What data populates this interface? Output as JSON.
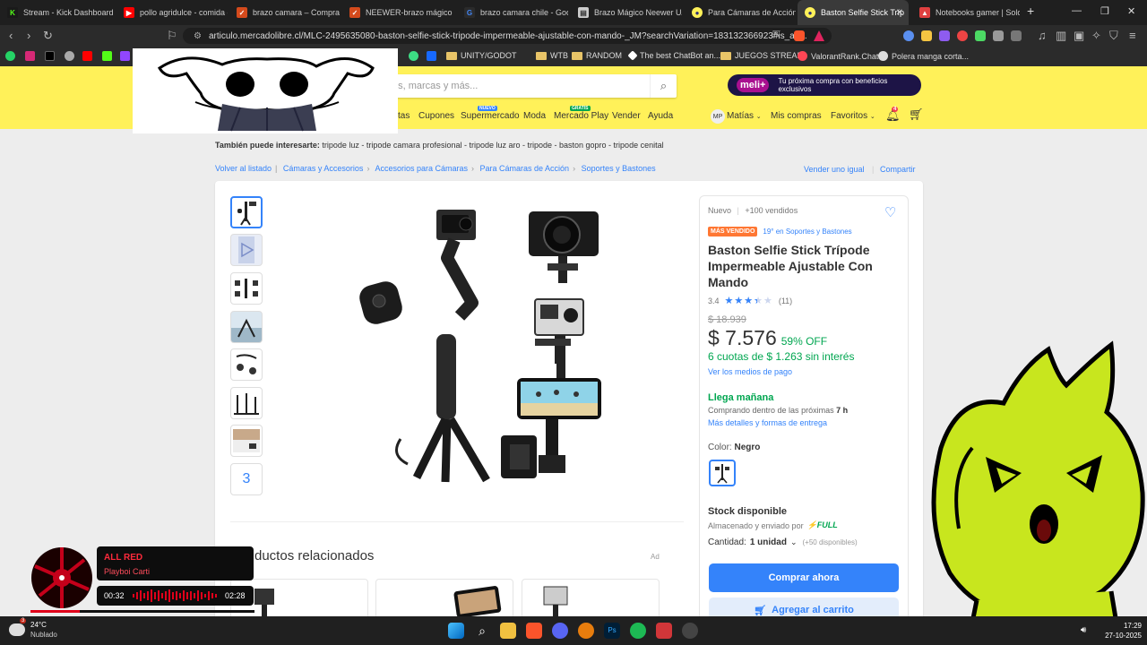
{
  "browser": {
    "tabs": [
      {
        "title": "Stream - Kick Dashboard",
        "icon": "kick-icon",
        "color": "#53fc18"
      },
      {
        "title": "pollo agridulce - comida c",
        "icon": "youtube-icon",
        "color": "#ff0000"
      },
      {
        "title": "brazo camara – Compra b",
        "icon": "mercadolibre-icon",
        "color": "#d44a1c"
      },
      {
        "title": "NEEWER-brazo mágico de",
        "icon": "aliexpress-icon",
        "color": "#d44a1c"
      },
      {
        "title": "brazo camara chile - Goog",
        "icon": "google-icon",
        "color": "#4285f4"
      },
      {
        "title": "Brazo Mágico Neewer UA",
        "icon": "page-icon",
        "color": "#cccccc"
      },
      {
        "title": "Para Cámaras de Acción S",
        "icon": "mercadolibre-icon",
        "color": "#fff159"
      },
      {
        "title": "Baston Selfie Stick Tríp",
        "icon": "mercadolibre-icon",
        "color": "#fff159",
        "active": true
      },
      {
        "title": "Notebooks gamer | SoloTo",
        "icon": "solotodo-icon",
        "color": "#e04040"
      }
    ],
    "new_tab": "+",
    "url": "articulo.mercadolibre.cl/MLC-2495635080-baston-selfie-stick-tripode-impermeable-ajustable-con-mando-_JM?searchVariation=183132366923#is_ad...",
    "bookmarks": [
      {
        "label": "UNITY/GODOT",
        "type": "folder"
      },
      {
        "label": "WTB",
        "type": "folder"
      },
      {
        "label": "RANDOM",
        "type": "folder"
      },
      {
        "label": "The best ChatBot an...",
        "type": "link"
      },
      {
        "label": "JUEGOS STREAM",
        "type": "folder"
      },
      {
        "label": "ValorantRank.Chat",
        "type": "link"
      },
      {
        "label": "Polera manga corta...",
        "type": "link"
      }
    ]
  },
  "header": {
    "search_placeholder": "os, marcas y más...",
    "meliplus_logo": "meli+",
    "meliplus_text": "Tu próxima compra con beneficios exclusivos",
    "nav": [
      "tas",
      "Cupones",
      "Supermercado",
      "Moda",
      "Mercado Play",
      "Vender",
      "Ayuda"
    ],
    "badge_nuevo": "NUEVO",
    "badge_gratis": "GRATIS",
    "user_initials": "MP",
    "user_name": "Matías",
    "mis_compras": "Mis compras",
    "favoritos": "Favoritos",
    "notif_count": "4"
  },
  "page": {
    "interes_label": "También puede interesarte:",
    "interes_items": "tripode luz - tripode camara profesional - tripode luz aro - tripode - baston gopro - tripode cenital",
    "breadcrumbs": [
      "Volver al listado",
      "Cámaras y Accesorios",
      "Accesorios para Cámaras",
      "Para Cámaras de Acción",
      "Soportes y Bastones"
    ],
    "vender_igual": "Vender uno igual",
    "compartir": "Compartir",
    "more_thumbs": "3",
    "related_title": "ductos relacionados",
    "ad_label": "Ad"
  },
  "product": {
    "condition": "Nuevo",
    "sold": "+100 vendidos",
    "badge": "MÁS VENDIDO",
    "ranking": "19° en Soportes y Bastones",
    "title": "Baston Selfie Stick Trípode Impermeable Ajustable Con Mando",
    "rating": "3.4",
    "rating_value": 3.4,
    "reviews": "(11)",
    "old_price": "$ 18.939",
    "price": "$ 7.576",
    "discount": "59% OFF",
    "installments": "6 cuotas de $ 1.263 sin interés",
    "payment_link": "Ver los medios de pago",
    "delivery": "Llega mañana",
    "delivery_sub": "Comprando dentro de las próximas",
    "delivery_hours": "7 h",
    "delivery_link": "Más detalles y formas de entrega",
    "color_label": "Color:",
    "color_value": "Negro",
    "stock": "Stock disponible",
    "shipping_note": "Almacenado y enviado por",
    "full": "FULL",
    "qty_label": "Cantidad:",
    "qty_value": "1 unidad",
    "qty_available": "(+50 disponibles)",
    "buy_now": "Comprar ahora",
    "add_cart": "Agregar al carrito"
  },
  "music": {
    "song": "ALL RED",
    "artist": "Playboi Carti",
    "elapsed": "00:32",
    "total": "02:28",
    "progress": 0.22
  },
  "taskbar": {
    "weather_temp": "24°C",
    "weather_desc": "Nublado",
    "weather_badge": "3",
    "time": "17:29",
    "date": "27-10-2025"
  },
  "colors": {
    "ml_yellow": "#fff159",
    "ml_blue": "#3483fa",
    "ml_green": "#00a650",
    "best_seller": "#ff7733"
  }
}
